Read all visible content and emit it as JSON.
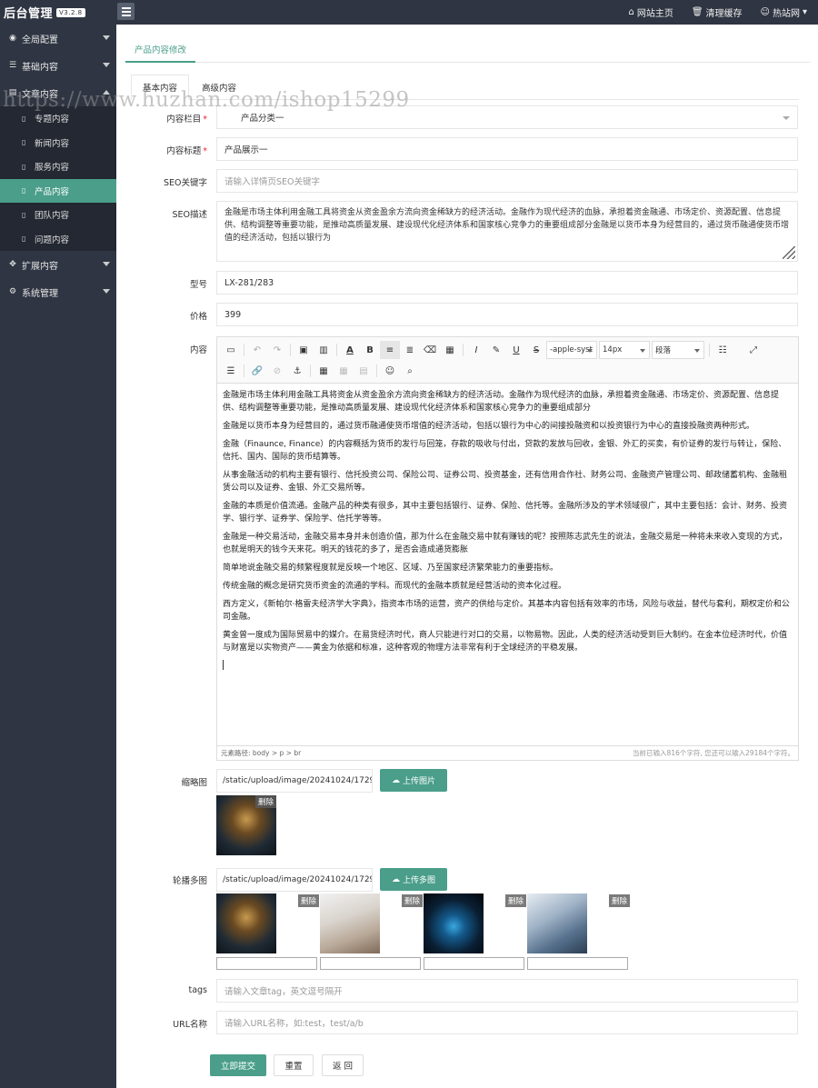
{
  "app": {
    "title": "后台管理",
    "version": "V3.2.8"
  },
  "topbar": {
    "home": "网站主页",
    "clear_cache": "清理缓存",
    "user": "热站网"
  },
  "sidebar": {
    "groups": [
      {
        "label": "全局配置",
        "icon": "globe-icon"
      },
      {
        "label": "基础内容",
        "icon": "sliders-icon"
      },
      {
        "label": "文章内容",
        "icon": "file-icon"
      }
    ],
    "sub_items": [
      "专题内容",
      "新闻内容",
      "服务内容",
      "产品内容",
      "团队内容",
      "问题内容"
    ],
    "active_item": "产品内容",
    "groups_after": [
      {
        "label": "扩展内容",
        "icon": "expand-icon"
      },
      {
        "label": "系统管理",
        "icon": "gear-icon"
      }
    ]
  },
  "breadcrumb": {
    "tab": "产品内容修改"
  },
  "watermark": "https://www.huzhan.com/ishop15299",
  "tabs": [
    "基本内容",
    "高级内容"
  ],
  "form": {
    "category": {
      "label": "内容栏目",
      "value": "产品分类一"
    },
    "title": {
      "label": "内容标题",
      "value": "产品展示一"
    },
    "seo_keywords": {
      "label": "SEO关键字",
      "placeholder": "请输入详情页SEO关键字"
    },
    "seo_desc": {
      "label": "SEO描述",
      "value": "金融是市场主体利用金融工具将资金从资金盈余方流向资金稀缺方的经济活动。金融作为现代经济的血脉，承担着资金融通、市场定价、资源配置、信息提供、结构调整等重要功能，是推动高质量发展、建设现代化经济体系和国家核心竞争力的重要组成部分金融是以货币本身为经营目的，通过货币融通使货币增值的经济活动，包括以银行为"
    },
    "model": {
      "label": "型号",
      "value": "LX-281/283"
    },
    "price": {
      "label": "价格",
      "value": "399"
    },
    "content_label": "内容",
    "thumb": {
      "label": "缩略图",
      "path": "/static/upload/image/20241024/172972",
      "button": "上传图片",
      "delete": "删除"
    },
    "gallery": {
      "label": "轮播多图",
      "path": "/static/upload/image/20241024/172972",
      "button": "上传多图",
      "delete": "删除"
    },
    "tags": {
      "label": "tags",
      "placeholder": "请输入文章tag，英文逗号隔开"
    },
    "url_name": {
      "label": "URL名称",
      "placeholder": "请输入URL名称，如:test，test/a/b"
    }
  },
  "editor": {
    "font": "-apple-syst",
    "size": "14px",
    "para": "段落",
    "paragraphs": [
      "金融是市场主体利用金融工具将资金从资金盈余方流向资金稀缺方的经济活动。金融作为现代经济的血脉，承担着资金融通、市场定价、资源配置、信息提供、结构调整等重要功能，是推动高质量发展、建设现代化经济体系和国家核心竞争力的重要组成部分",
      "金融是以货币本身为经营目的，通过货币融通使货币增值的经济活动，包括以银行为中心的间接投融资和以投资银行为中心的直接投融资两种形式。",
      "金融（Finaunce, Finance）的内容概括为货币的发行与回笼，存款的吸收与付出，贷款的发放与回收，金银、外汇的买卖，有价证券的发行与转让，保险、信托、国内、国际的货币结算等。",
      "从事金融活动的机构主要有银行、信托投资公司、保险公司、证券公司、投资基金，还有信用合作社、财务公司、金融资产管理公司、邮政储蓄机构、金融租赁公司以及证券、金银、外汇交易所等。",
      "金融的本质是价值流通。金融产品的种类有很多，其中主要包括银行、证券、保险、信托等。金融所涉及的学术领域很广，其中主要包括：会计、财务、投资学、银行学、证券学、保险学、信托学等等。",
      "金融是一种交易活动，金融交易本身并未创造价值，那为什么在金融交易中就有赚钱的呢？按照陈志武先生的说法，金融交易是一种将未来收入变现的方式，也就是明天的钱今天来花。明天的钱花的多了，是否会造成通货膨胀",
      "简单地说金融交易的频繁程度就是反映一个地区、区域、乃至国家经济繁荣能力的重要指标。",
      "传统金融的概念是研究货币资金的流通的学科。而现代的金融本质就是经营活动的资本化过程。",
      "西方定义，《新帕尔·格雷夫经济学大字典》，指资本市场的运营，资产的供给与定价。其基本内容包括有效率的市场，风险与收益，替代与套利，期权定价和公司金融。",
      "黄金曾一度成为国际贸易中的媒介。在易货经济时代，商人只能进行对口的交易，以物易物。因此，人类的经济活动受到巨大制约。在金本位经济时代，价值与财富是以实物资产——黄金为依据和标准，这种客观的物理方法非常有利于全球经济的平稳发展。"
    ],
    "path": "元素路径: body > p > br",
    "count": "当前已输入816个字符, 您还可以输入29184个字符。"
  },
  "buttons": {
    "submit": "立即提交",
    "reset": "重置",
    "back": "返 回"
  },
  "colors": {
    "primary": "#4a9e8a",
    "sidebar": "#2f3542"
  }
}
